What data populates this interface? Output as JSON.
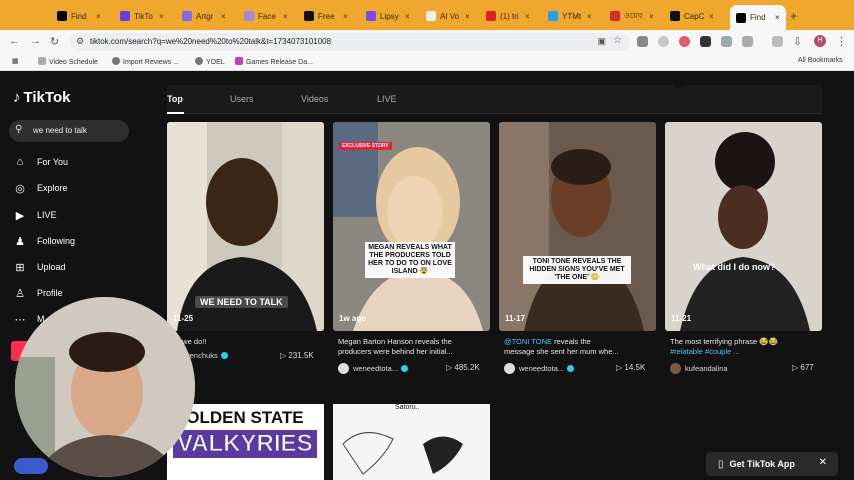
{
  "browser": {
    "tabs": [
      {
        "label": "Find",
        "color": "#000000"
      },
      {
        "label": "TikTo",
        "color": "#6a3de8"
      },
      {
        "label": "Artgr",
        "color": "#8a6ae0"
      },
      {
        "label": "Face",
        "color": "#9a8ae0"
      },
      {
        "label": "Free",
        "color": "#111111"
      },
      {
        "label": "Lipsy",
        "color": "#7a4af0"
      },
      {
        "label": "AI Vo",
        "color": "#eeeeee"
      },
      {
        "label": "(1) tri",
        "color": "#e02020"
      },
      {
        "label": "YTMt",
        "color": "#1da1f2"
      },
      {
        "label": "ওয়েব",
        "color": "#d23030"
      },
      {
        "label": "CapC",
        "color": "#111111"
      },
      {
        "label": "Find",
        "color": "#000000"
      }
    ],
    "url": "tiktok.com/search?q=we%20need%20to%20talk&t=1734073101008",
    "profile_initial": "H",
    "bookmarks": [
      "Video Schedule",
      "Import Reviews ...",
      "YOEL",
      "Games Release Da..."
    ],
    "all_bookmarks": "All Bookmarks"
  },
  "tiktok": {
    "logo": "TikTok",
    "search_value": "we need to talk",
    "nav": [
      {
        "label": "For You",
        "icon": "home-icon"
      },
      {
        "label": "Explore",
        "icon": "compass-icon"
      },
      {
        "label": "LIVE",
        "icon": "live-icon"
      },
      {
        "label": "Following",
        "icon": "following-icon"
      },
      {
        "label": "Upload",
        "icon": "upload-icon"
      },
      {
        "label": "Profile",
        "icon": "profile-icon"
      },
      {
        "label": "M",
        "icon": "more-icon"
      }
    ],
    "tabs": [
      "Top",
      "Users",
      "Videos",
      "LIVE"
    ],
    "videos": [
      {
        "date": "11-25",
        "overlay": "WE NEED TO TALK",
        "caption": "o we do!!",
        "author": "stevenchuks",
        "verified": true,
        "plays": "231.5K"
      },
      {
        "date": "1w ago",
        "badge": "EXCLUSIVE STORY",
        "overlay": "MEGAN REVEALS WHAT THE PRODUCERS TOLD HER TO DO TO ON LOVE ISLAND 😨",
        "caption_line1": "Megan Barton Hanson reveals the",
        "caption_line2": "producers were behind her initial...",
        "author": "weneedtota...",
        "verified": true,
        "plays": "485.2K"
      },
      {
        "date": "11-17",
        "overlay": "TONI TONE REVEALS THE HIDDEN SIGNS YOU'VE MET 'THE ONE' 😳",
        "caption_mention": "@TONI TONE",
        "caption_line1": " reveals the",
        "caption_line2": "message she sent her mum whe...",
        "author": "weneedtota...",
        "verified": true,
        "plays": "14.5K"
      },
      {
        "date": "11-21",
        "overlay": "What did I do now?",
        "caption_line1": "The most terrifying phrase 😂😂",
        "caption_tags": "#relatable #couple ...",
        "author": "kufeandalina",
        "verified": false,
        "plays": "677"
      }
    ],
    "row2": {
      "card1_text": "GOLDEN STATE",
      "card1_text2": "VALKYRIES",
      "card2_text": "Satoru.."
    },
    "get_app": "Get TikTok App"
  }
}
